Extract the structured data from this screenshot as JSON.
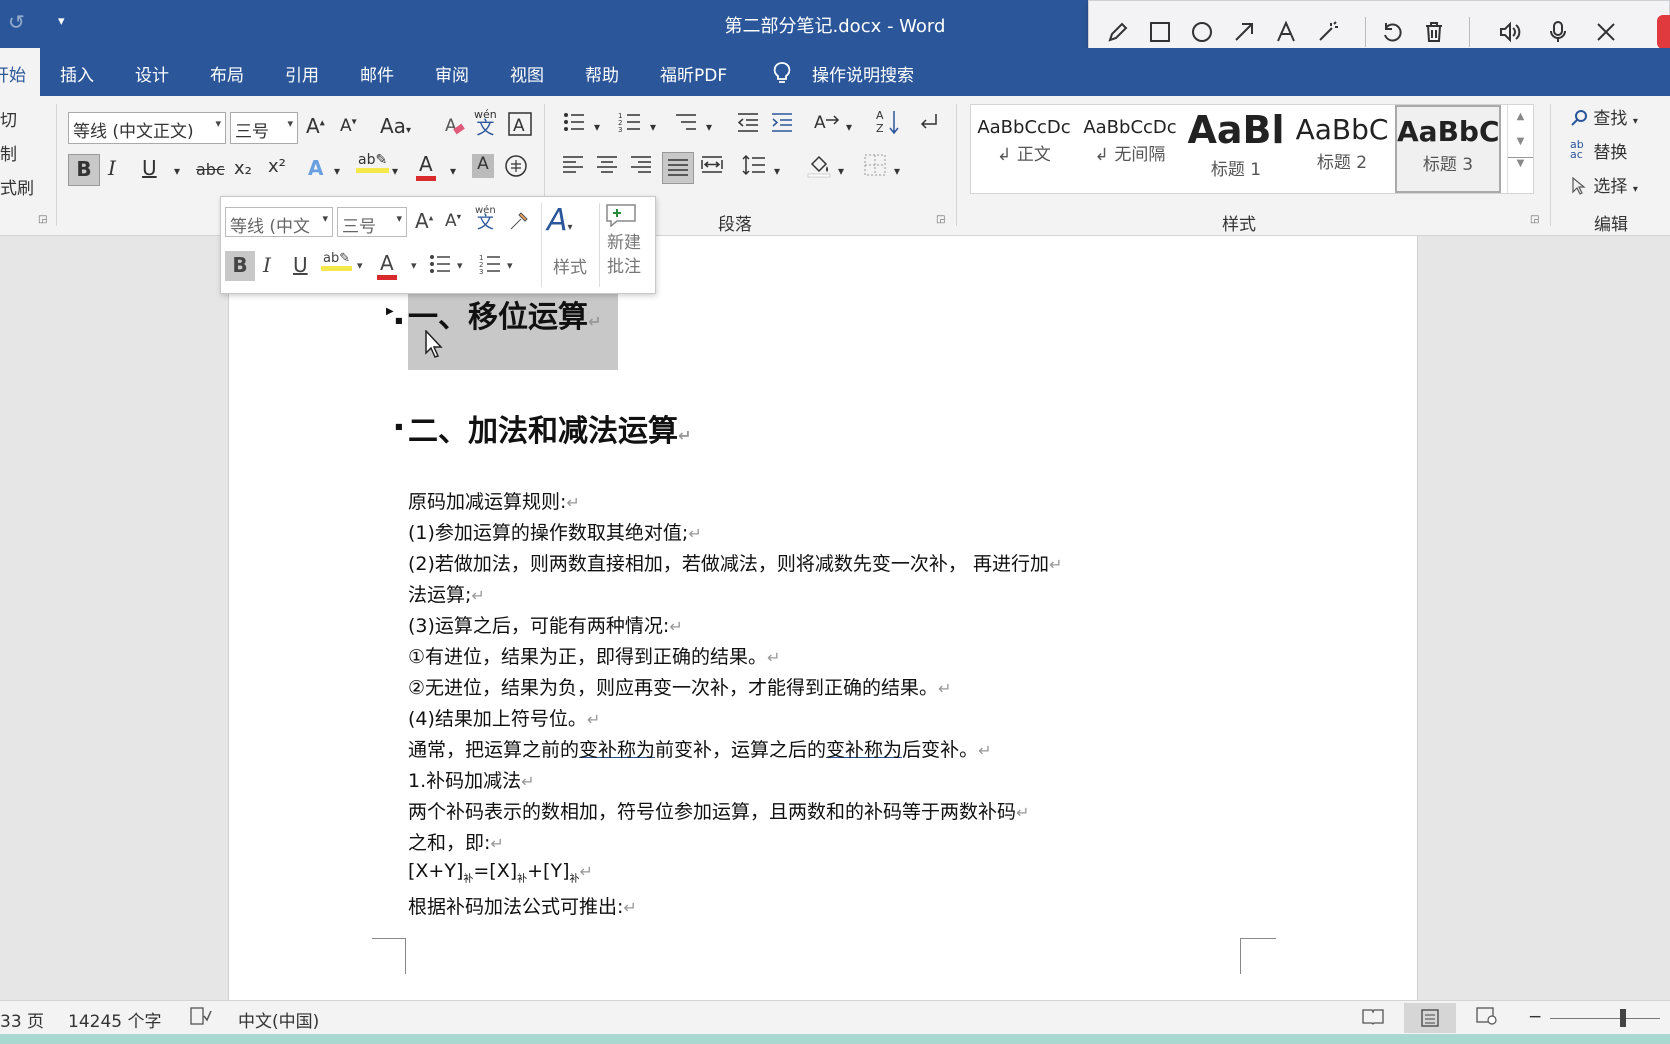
{
  "window": {
    "title": "第二部分笔记.docx  -  Word"
  },
  "tabs": {
    "home": "开始",
    "items": [
      "插入",
      "设计",
      "布局",
      "引用",
      "邮件",
      "审阅",
      "视图",
      "帮助",
      "福昕PDF"
    ],
    "search": "操作说明搜索"
  },
  "clipboard": {
    "cut": "切",
    "copy": "制",
    "format_painter": "式刷"
  },
  "font": {
    "name": "等线 (中文正文)",
    "size": "三号",
    "change_case": "Aa",
    "phonetic_top": "wén",
    "phonetic_bottom": "文",
    "bold": "B",
    "italic": "I",
    "underline": "U",
    "strike": "abc",
    "subscript": "x₂",
    "superscript": "x²",
    "effects": "A",
    "highlight": "ab",
    "color": "A"
  },
  "paragraph": {
    "label": "段落"
  },
  "styles": {
    "label": "样式",
    "items": [
      {
        "preview": "AaBbCcDc",
        "label": "正文"
      },
      {
        "preview": "AaBbCcDc",
        "label": "无间隔"
      },
      {
        "preview": "AaBl",
        "label": "标题 1"
      },
      {
        "preview": "AaBbC",
        "label": "标题 2"
      },
      {
        "preview": "AaBbC",
        "label": "标题 3"
      }
    ]
  },
  "editing": {
    "label": "编辑",
    "find": "查找",
    "replace": "替换",
    "select": "选择"
  },
  "mini_toolbar": {
    "font": "等线 (中文",
    "size": "三号",
    "styles": "样式",
    "new_comment_line1": "新建",
    "new_comment_line2": "批注"
  },
  "document": {
    "heading1": "一、移位运算",
    "heading2": "二、加法和减法运算",
    "lines": [
      "原码加减运算规则:",
      "(1)参加运算的操作数取其绝对值;",
      "(2)若做加法，则两数直接相加，若做减法，则将减数先变一次补，  再进行加",
      "法运算;",
      "(3)运算之后，可能有两种情况:",
      "①有进位，结果为正，即得到正确的结果。",
      "②无进位，结果为负，则应再变一次补，才能得到正确的结果。",
      "(4)结果加上符号位。"
    ],
    "line_usual_a": "通常，把运算之前的",
    "line_usual_b": "变补称为",
    "line_usual_c": "前变补，运算之后的",
    "line_usual_d": "变补称为",
    "line_usual_e": "后变补。",
    "lines2": [
      "1.补码加减法",
      "两个补码表示的数相加，符号位参加运算，且两数和的补码等于两数补码",
      "之和，即:"
    ],
    "formula_a": "[X+Y]",
    "formula_sub": "补",
    "formula_b": "=[X]",
    "formula_c": "+[Y]",
    "last_line": "根据补码加法公式可推出:",
    "pilcrow": "↵"
  },
  "status": {
    "page": "33 页",
    "words": "14245 个字",
    "language": "中文(中国)"
  },
  "colors": {
    "word_blue": "#2b579a",
    "red": "#d92b2b",
    "highlight_yellow": "#f5e84a",
    "selection_gray": "#c8c8c8"
  }
}
